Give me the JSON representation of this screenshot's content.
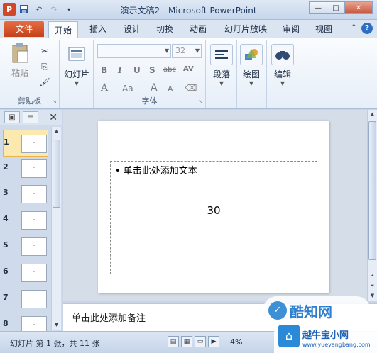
{
  "window": {
    "title": "演示文稿2 - Microsoft PowerPoint",
    "app_icon": "P",
    "minimize": "—",
    "maximize": "□",
    "close": "✕"
  },
  "qat": {
    "save_icon": "save-icon",
    "undo_icon": "undo-icon",
    "redo_icon": "redo-icon"
  },
  "tabs": {
    "file": "文件",
    "items": [
      "开始",
      "插入",
      "设计",
      "切换",
      "动画",
      "幻灯片放映",
      "审阅",
      "视图"
    ],
    "help": "?"
  },
  "ribbon": {
    "clipboard": {
      "paste": "粘贴",
      "label": "剪贴板"
    },
    "slides": {
      "new_slide": "幻灯片"
    },
    "font": {
      "font_name": "",
      "font_size": "32",
      "bold": "B",
      "italic": "I",
      "underline": "U",
      "shadow": "S",
      "strike": "abc",
      "spacing": "AV",
      "font_color": "A",
      "change_case": "Aa",
      "grow": "A",
      "shrink": "A",
      "label": "字体"
    },
    "paragraph": {
      "label": "段落"
    },
    "drawing": {
      "label": "绘图"
    },
    "editing": {
      "label": "编辑"
    }
  },
  "left_panel": {
    "thumbnails": [
      "1",
      "2",
      "3",
      "4",
      "5",
      "6",
      "7",
      "8"
    ],
    "active_index": 0
  },
  "slide": {
    "bullet_text": "• 单击此处添加文本",
    "number": "30"
  },
  "notes": {
    "placeholder": "单击此处添加备注"
  },
  "status": {
    "slide_info": "幻灯片 第 1 张，共 11 张",
    "zoom": "4%"
  },
  "watermarks": {
    "brand1": "酷知网",
    "brand2_line1": "越牛宝小网",
    "brand2_line2": "www.yueyangbang.com"
  },
  "colors": {
    "file_tab": "#c54119",
    "ribbon_bg": "#fafcfe",
    "active_thumb": "#fbe9b0"
  }
}
